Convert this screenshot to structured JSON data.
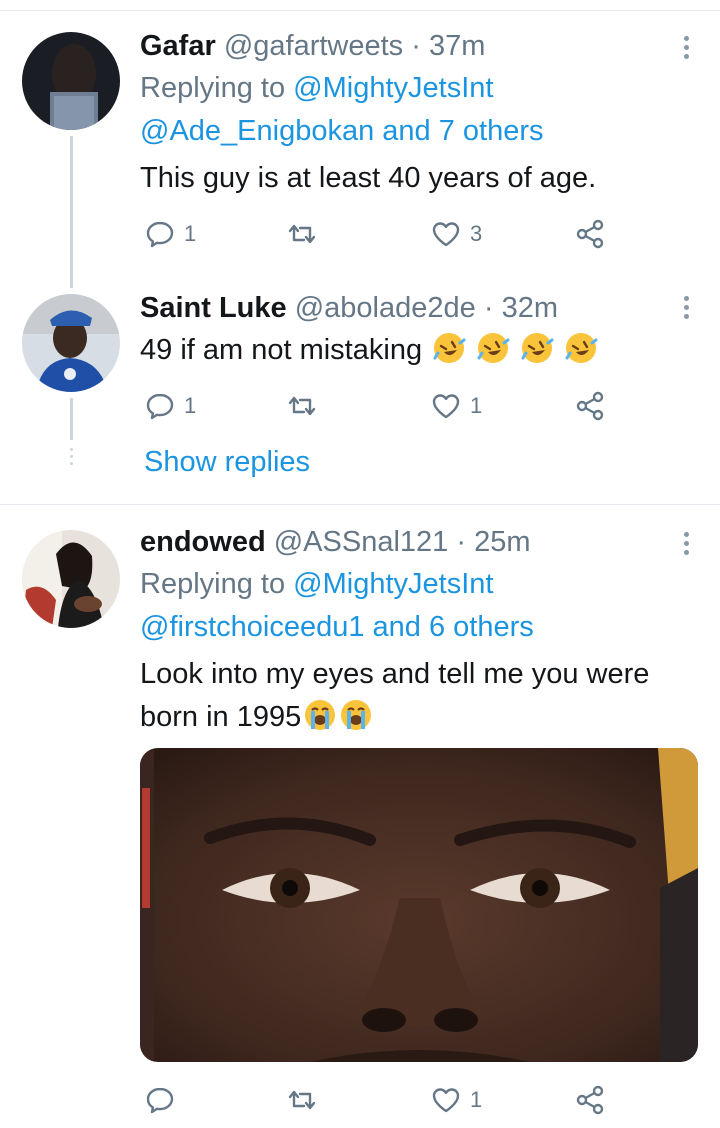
{
  "tweets": [
    {
      "name": "Gafar",
      "handle": "@gafartweets",
      "time": "37m",
      "replying_prefix": "Replying to",
      "replying_to": "@MightyJetsInt",
      "also_replying": "@Ade_Enigbokan and 7 others",
      "text": "This guy is at least 40 years of age.",
      "replies": "1",
      "likes": "3"
    },
    {
      "name": "Saint Luke",
      "handle": "@abolade2de",
      "time": "32m",
      "text": "49 if am not mistaking",
      "emoji": [
        "rolling-on-floor-laughing",
        "rolling-on-floor-laughing",
        "rolling-on-floor-laughing",
        "rolling-on-floor-laughing"
      ],
      "replies": "1",
      "likes": "1",
      "show_replies": "Show replies"
    },
    {
      "name": "endowed",
      "handle": "@ASSnal121",
      "time": "25m",
      "replying_prefix": "Replying to",
      "replying_to": "@MightyJetsInt",
      "also_replying": "@firstchoiceedu1 and 6 others",
      "text_line1": "Look into my eyes and tell me you were",
      "text_line2": "born in 1995",
      "emoji": [
        "loudly-crying-face",
        "loudly-crying-face"
      ],
      "likes": "1"
    }
  ],
  "separator": "·",
  "colors": {
    "link": "#1b95e0",
    "muted": "#657786",
    "text": "#14171a"
  },
  "icons": {
    "reply": "reply-icon",
    "retweet": "retweet-icon",
    "like": "heart-icon",
    "share": "share-icon",
    "more": "more-vertical-icon"
  }
}
